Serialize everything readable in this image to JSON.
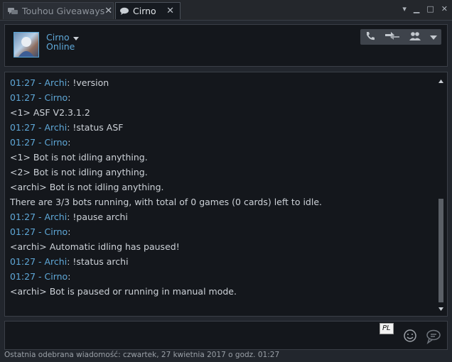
{
  "tabs": [
    {
      "label": "Touhou Giveaways",
      "close": "✕",
      "icon": "group-chat-icon"
    },
    {
      "label": "Cirno",
      "close": "✕",
      "icon": "chat-bubble-icon"
    }
  ],
  "window_controls": {
    "menu": "▾",
    "minimize": "▁",
    "maximize": "□",
    "close": "✕"
  },
  "contact": {
    "name": "Cirno",
    "status": "Online"
  },
  "header_actions": [
    "voice-call-icon",
    "send-file-icon",
    "add-to-group-icon",
    "more-dropdown-icon"
  ],
  "messages": [
    {
      "time": "01:27",
      "dash": " - ",
      "author": "Archi",
      "sep": ": ",
      "text": "!version"
    },
    {
      "time": "01:27",
      "dash": " - ",
      "author": "Cirno",
      "sep": ":",
      "text": ""
    },
    {
      "text": "<1> ASF V2.3.1.2"
    },
    {
      "time": "01:27",
      "dash": " - ",
      "author": "Archi",
      "sep": ": ",
      "text": "!status ASF"
    },
    {
      "time": "01:27",
      "dash": " - ",
      "author": "Cirno",
      "sep": ":",
      "text": ""
    },
    {
      "text": "<1> Bot is not idling anything."
    },
    {
      "text": "<2> Bot is not idling anything."
    },
    {
      "text": "<archi> Bot is not idling anything."
    },
    {
      "text": "There are 3/3 bots running, with total of 0 games (0 cards) left to idle."
    },
    {
      "time": "01:27",
      "dash": " - ",
      "author": "Archi",
      "sep": ": ",
      "text": "!pause archi"
    },
    {
      "time": "01:27",
      "dash": " - ",
      "author": "Cirno",
      "sep": ":",
      "text": ""
    },
    {
      "text": "<archi> Automatic idling has paused!"
    },
    {
      "time": "01:27",
      "dash": " - ",
      "author": "Archi",
      "sep": ": ",
      "text": "!status archi"
    },
    {
      "time": "01:27",
      "dash": " - ",
      "author": "Cirno",
      "sep": ":",
      "text": ""
    },
    {
      "text": "<archi> Bot is paused or running in manual mode."
    }
  ],
  "input": {
    "value": "",
    "language_badge": "PL"
  },
  "footer": {
    "status_text": "Ostatnia odebrana wiadomość: czwartek, 27 kwietnia 2017 o godz. 01:27"
  },
  "colors": {
    "accent": "#5fa8d8",
    "background": "#14171c",
    "chrome": "#22262d"
  }
}
